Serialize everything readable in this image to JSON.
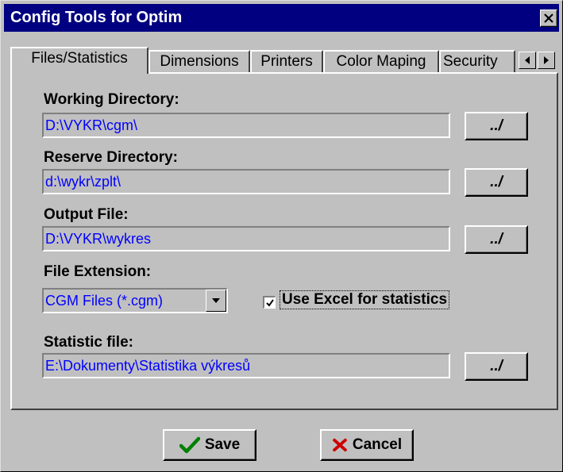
{
  "window": {
    "title": "Config Tools for Optim"
  },
  "tabs": [
    {
      "label": "Files/Statistics",
      "active": true
    },
    {
      "label": "Dimensions"
    },
    {
      "label": "Printers"
    },
    {
      "label": "Color Maping"
    },
    {
      "label": "Security"
    }
  ],
  "fields": {
    "working_directory": {
      "label": "Working Directory:",
      "value": "D:\\VYKR\\cgm\\",
      "browse_label": "../"
    },
    "reserve_directory": {
      "label": "Reserve Directory:",
      "value": "d:\\wykr\\zplt\\",
      "browse_label": "../"
    },
    "output_file": {
      "label": "Output File:",
      "value": "D:\\VYKR\\wykres",
      "browse_label": "../"
    },
    "file_extension": {
      "label": "File Extension:",
      "selected": "CGM Files (*.cgm)"
    },
    "use_excel": {
      "label": "Use Excel for statistics",
      "checked": true
    },
    "statistic_file": {
      "label": "Statistic file:",
      "value": "E:\\Dokumenty\\Statistika výkresů",
      "browse_label": "../"
    }
  },
  "buttons": {
    "save_label": "Save",
    "cancel_label": "Cancel"
  },
  "icons": {
    "save": "checkmark-icon",
    "cancel": "x-icon",
    "close": "close-icon"
  },
  "colors": {
    "titlebar": "#000080",
    "field_text": "#0000ff",
    "checkmark": "#008000",
    "cancel_x": "#cc0000"
  }
}
